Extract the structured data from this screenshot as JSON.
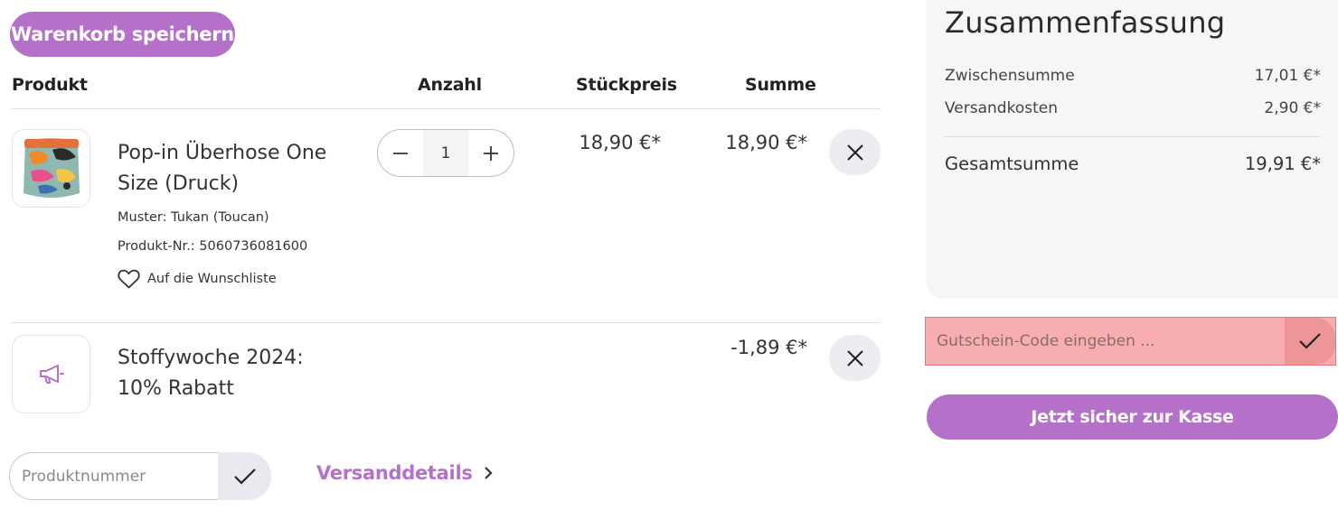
{
  "cart": {
    "save_label": "Warenkorb speichern",
    "headers": {
      "product": "Produkt",
      "quantity": "Anzahl",
      "unit_price": "Stückpreis",
      "total": "Summe"
    },
    "items": [
      {
        "name": "Pop-in Überhose One Size (Druck)",
        "pattern": "Muster: Tukan (Toucan)",
        "sku": "Produkt-Nr.: 5060736081600",
        "wishlist_label": "Auf die Wunschliste",
        "quantity": "1",
        "unit_price": "18,90 €*",
        "total": "18,90 €*",
        "icon": "product-image"
      },
      {
        "name": "Stoffywoche 2024: 10% Rabatt",
        "total": "-1,89 €*",
        "icon": "megaphone-icon"
      }
    ],
    "product_number": {
      "placeholder": "Produktnummer"
    },
    "shipping_link": "Versanddetails"
  },
  "summary": {
    "title": "Zusammenfassung",
    "subtotal_label": "Zwischensumme",
    "subtotal_value": "17,01 €*",
    "shipping_label": "Versandkosten",
    "shipping_value": "2,90 €*",
    "grand_total_label": "Gesamtsumme",
    "grand_total_value": "19,91 €*"
  },
  "coupon": {
    "placeholder": "Gutschein-Code eingeben ..."
  },
  "checkout_label": "Jetzt sicher zur Kasse",
  "colors": {
    "accent": "#b571c9",
    "coupon_error_bg": "#f8adaf",
    "coupon_error_border": "#e27478",
    "summary_bg": "#f6f6f6"
  }
}
